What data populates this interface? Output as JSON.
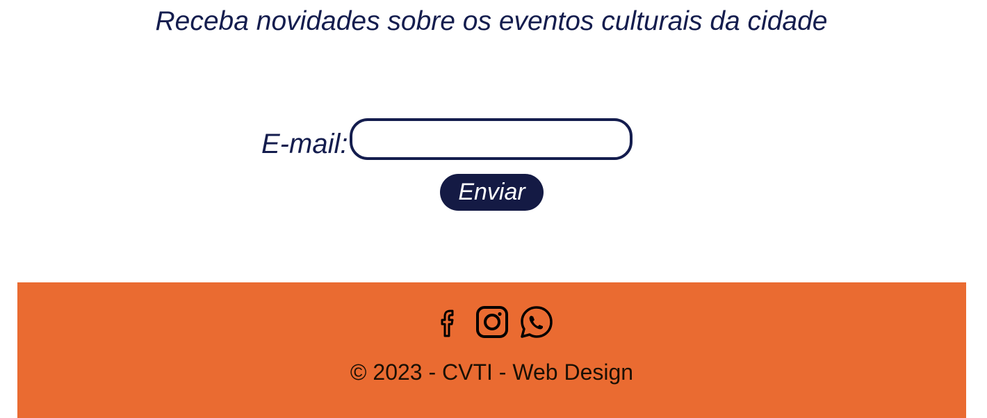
{
  "newsletter": {
    "headline": "Receba novidades sobre os eventos culturais da cidade",
    "email_label": "E-mail:",
    "email_value": "",
    "email_placeholder": "",
    "submit_label": "Enviar"
  },
  "footer": {
    "social_icons": [
      "facebook-icon",
      "instagram-icon",
      "whatsapp-icon"
    ],
    "copyright": "© 2023 - CVTI - Web Design"
  },
  "colors": {
    "primary_navy": "#141d4e",
    "footer_orange": "#ea6b31",
    "footer_text": "#1b1005",
    "background": "#ffffff"
  }
}
